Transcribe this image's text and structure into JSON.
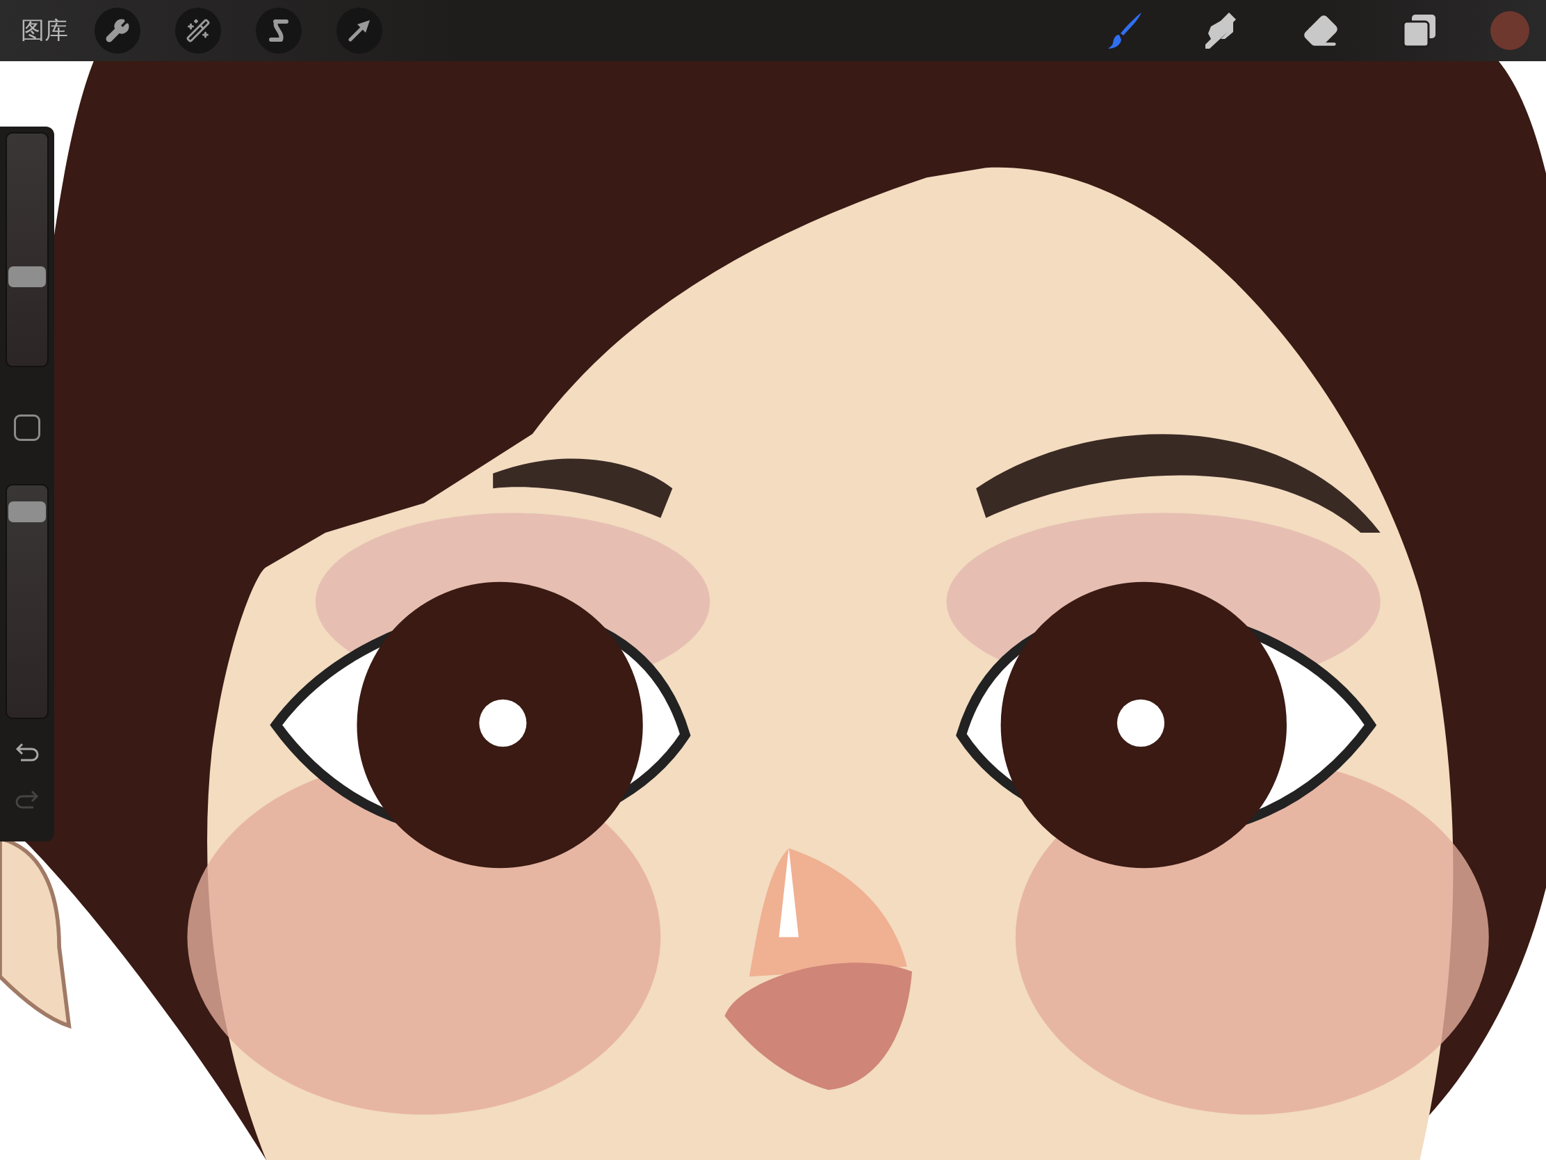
{
  "toolbar": {
    "gallery": "图库",
    "actions": [
      {
        "kind": "wrench"
      },
      {
        "kind": "wand"
      },
      {
        "kind": "selection"
      },
      {
        "kind": "transform"
      }
    ],
    "tools": [
      {
        "kind": "brush",
        "selected": true
      },
      {
        "kind": "smudge",
        "selected": false
      },
      {
        "kind": "eraser",
        "selected": false
      },
      {
        "kind": "layers",
        "selected": false
      }
    ],
    "color": "#6e382e"
  },
  "sidebar": {
    "size_slider": {
      "level": 0.37
    },
    "modify_button": {
      "pressed": false
    },
    "opacity_slider": {
      "level": 0.93
    },
    "undo": {
      "disabled": false
    },
    "redo": {
      "disabled": true
    }
  }
}
